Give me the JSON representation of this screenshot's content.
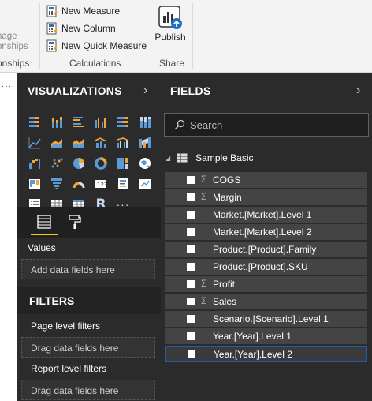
{
  "ribbon": {
    "relationships": {
      "line1": "nage",
      "line2": "onships",
      "group_label": "onships"
    },
    "calculations": {
      "items": [
        {
          "label": "New Measure",
          "icon": "calculator-icon"
        },
        {
          "label": "New Column",
          "icon": "calculator-icon"
        },
        {
          "label": "New Quick Measure",
          "icon": "calculator-icon"
        }
      ],
      "group_label": "Calculations"
    },
    "share": {
      "publish_label": "Publish",
      "group_label": "Share"
    }
  },
  "left_strip": {
    "more": "⋮"
  },
  "visualizations": {
    "title": "VISUALIZATIONS",
    "collapse": "›",
    "icons": [
      "stacked-bar-chart-icon",
      "stacked-column-chart-icon",
      "clustered-bar-chart-icon",
      "clustered-column-chart-icon",
      "100-stacked-bar-chart-icon",
      "100-stacked-column-chart-icon",
      "line-chart-icon",
      "area-chart-icon",
      "stacked-area-chart-icon",
      "line-and-stacked-column-chart-icon",
      "line-and-clustered-column-chart-icon",
      "ribbon-chart-icon",
      "waterfall-chart-icon",
      "scatter-chart-icon",
      "pie-chart-icon",
      "donut-chart-icon",
      "treemap-icon",
      "map-icon",
      "filled-map-icon",
      "funnel-chart-icon",
      "gauge-icon",
      "card-icon",
      "multi-row-card-icon",
      "kpi-icon",
      "slicer-icon",
      "table-icon",
      "matrix-icon",
      "r-visual-icon",
      "more-visuals-icon"
    ],
    "r_glyph": "R",
    "more_glyph": "···",
    "values_label": "Values",
    "values_placeholder": "Add data fields here"
  },
  "filters": {
    "title": "FILTERS",
    "page_level_label": "Page level filters",
    "page_placeholder": "Drag data fields here",
    "report_level_label": "Report level filters",
    "report_placeholder": "Drag data fields here"
  },
  "fields": {
    "title": "FIELDS",
    "collapse": "›",
    "search_placeholder": "Search",
    "table_name": "Sample Basic",
    "items": [
      {
        "name": "COGS",
        "sigma": "Σ"
      },
      {
        "name": "Margin",
        "sigma": "Σ"
      },
      {
        "name": "Market.[Market].Level 1",
        "sigma": ""
      },
      {
        "name": "Market.[Market].Level 2",
        "sigma": ""
      },
      {
        "name": "Product.[Product].Family",
        "sigma": ""
      },
      {
        "name": "Product.[Product].SKU",
        "sigma": ""
      },
      {
        "name": "Profit",
        "sigma": "Σ"
      },
      {
        "name": "Sales",
        "sigma": "Σ"
      },
      {
        "name": "Scenario.[Scenario].Level 1",
        "sigma": ""
      },
      {
        "name": "Year.[Year].Level 1",
        "sigma": ""
      },
      {
        "name": "Year.[Year].Level 2",
        "sigma": ""
      }
    ],
    "selected_index": 10
  },
  "colors": {
    "pane_bg": "#2b2b2b",
    "field_bg": "#444444",
    "accent_yellow": "#f2c811",
    "selection_blue": "#1f5fa8"
  }
}
